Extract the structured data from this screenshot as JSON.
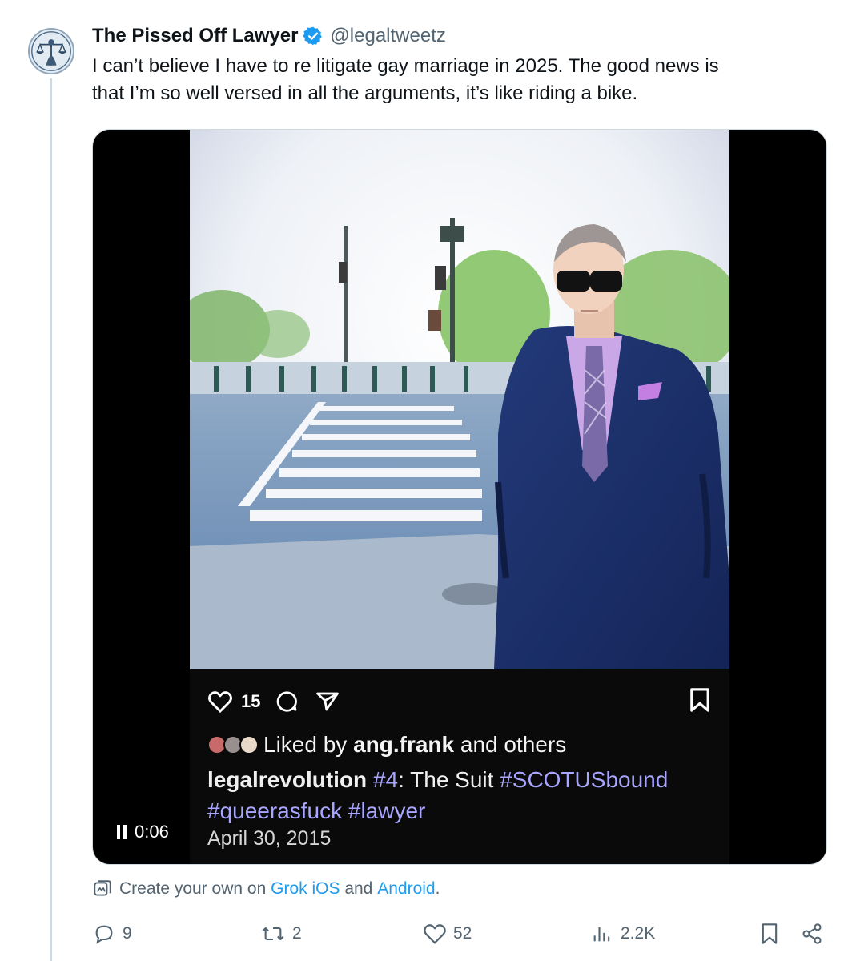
{
  "author": {
    "display_name": "The Pissed Off Lawyer",
    "handle": "@legaltweetz",
    "verified": true,
    "avatar_icon": "scales-of-justice-lady-justice-icon"
  },
  "tweet": {
    "text": "I can’t believe I have to re litigate gay marriage in 2025. The good news is\nthat I’m so well versed in all the arguments, it’s like riding a bike."
  },
  "media": {
    "type": "video",
    "elapsed_time": "0:06",
    "state": "playing",
    "instagram_post": {
      "like_count": "15",
      "liked_by_prefix": "Liked by",
      "liked_by_user": "ang.frank",
      "liked_by_suffix": "and others",
      "username": "legalrevolution",
      "caption_tag1": "#4",
      "caption_text": ": The Suit",
      "caption_tag2": "#SCOTUSbound",
      "caption_tag3": "#queerasfuck",
      "caption_tag4": "#lawyer",
      "date": "April 30, 2015"
    }
  },
  "grok_promo": {
    "prefix": "Create your own on",
    "link1": "Grok iOS",
    "middle": "and",
    "link2": "Android",
    "suffix": "."
  },
  "actions": {
    "replies": "9",
    "reposts": "2",
    "likes": "52",
    "views": "2.2K"
  },
  "colors": {
    "accent": "#1d9bf0",
    "verified_badge": "#1d9bf0",
    "secondary_text": "#536471",
    "thread_line": "#cfd9de",
    "hashtag": "#a9a6ff"
  }
}
